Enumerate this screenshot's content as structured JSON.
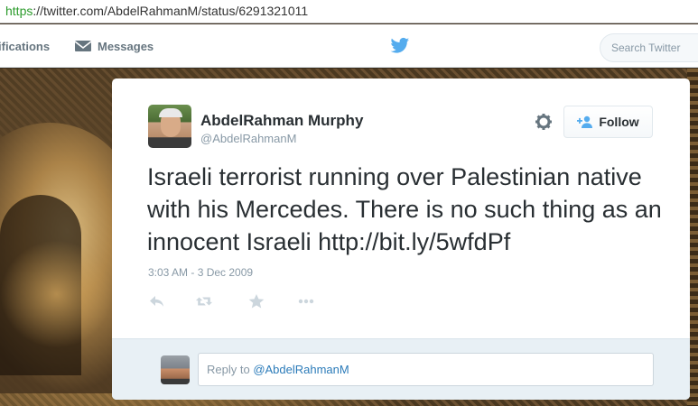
{
  "browser": {
    "url_scheme": "https",
    "url_rest": "://twitter.com/AbdelRahmanM/status/6291321011"
  },
  "topnav": {
    "notifications_label": "ifications",
    "messages_label": "Messages",
    "search_placeholder": "Search Twitter",
    "bird_icon": "twitter-bird-icon",
    "messages_icon": "envelope-icon"
  },
  "tweet": {
    "display_name": "AbdelRahman Murphy",
    "handle": "@AbdelRahmanM",
    "follow_label": "Follow",
    "text": "Israeli terrorist running over Palestinian native with his Mercedes. There is no such thing as an innocent Israeli http://bit.ly/5wfdPf",
    "timestamp": "3:03 AM - 3 Dec 2009",
    "actions": [
      "reply-icon",
      "retweet-icon",
      "favorite-icon",
      "more-icon"
    ]
  },
  "reply": {
    "prefix": "Reply to ",
    "mention": "@AbdelRahmanM"
  },
  "colors": {
    "accent": "#55acee",
    "link_blue": "#2b7bb9",
    "muted": "#8899a6",
    "text": "#292f33"
  }
}
